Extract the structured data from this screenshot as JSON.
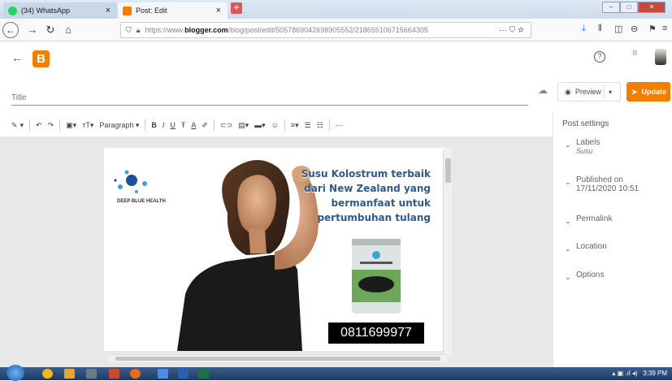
{
  "browser": {
    "tabs": [
      {
        "label": "(34) WhatsApp",
        "close": "×"
      },
      {
        "label": "Post: Edit",
        "close": "×"
      }
    ],
    "new_tab": "+",
    "url_prefix": "https://www.",
    "url_domain": "blogger.com",
    "url_path": "/blog/post/edit/5057869042698905552/218655106715664305",
    "url_actions": "··· ⛉ ☆"
  },
  "app": {
    "logo_letter": "B",
    "help_icon": "?",
    "apps_icon": "⋮⋮⋮"
  },
  "editor": {
    "title_placeholder": "Title",
    "preview_label": "Preview",
    "update_label": "Update",
    "toolbar": {
      "pen": "✎",
      "undo": "↶",
      "redo": "↷",
      "format": "Paragraph",
      "bold": "B",
      "italic": "I",
      "underline": "U",
      "strike": "Ŧ",
      "text_color": "A",
      "more": "···"
    }
  },
  "post_image": {
    "headline_lines": [
      "Susu Kolostrum terbaik",
      "dari New Zealand yang",
      "bermanfaat untuk",
      "pertumbuhan tulang"
    ],
    "brand": "DEEP BLUE HEALTH",
    "phone": "0811699977"
  },
  "sidebar": {
    "title": "Post settings",
    "items": [
      {
        "label": "Labels",
        "sub": "Susu"
      },
      {
        "label": "Published on",
        "sub": "17/11/2020 10:51"
      },
      {
        "label": "Permalink",
        "sub": ""
      },
      {
        "label": "Location",
        "sub": ""
      },
      {
        "label": "Options",
        "sub": ""
      }
    ]
  },
  "taskbar": {
    "time": "3:39 PM"
  },
  "colors": {
    "accent": "#f57d00",
    "taskbar": "#2a4a78"
  }
}
